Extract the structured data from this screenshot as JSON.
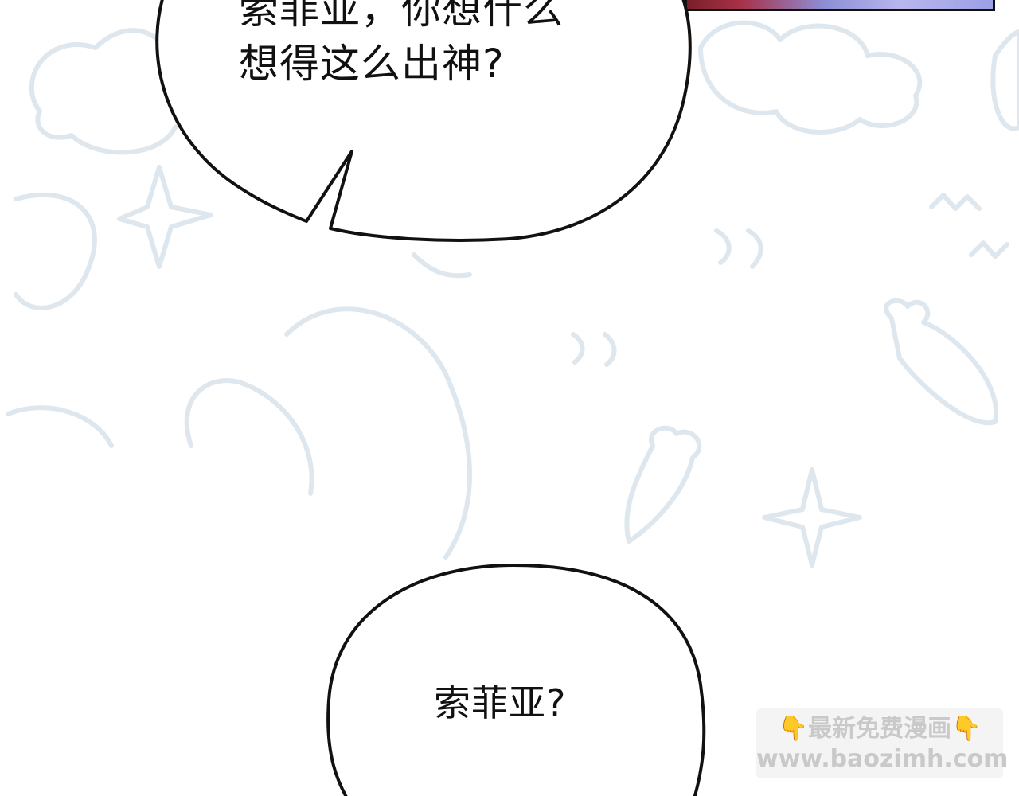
{
  "bubbles": {
    "top": {
      "line1": "索菲亚，你想什么",
      "line2": "想得这么出神?"
    },
    "bottom": {
      "text": "索菲亚?"
    }
  },
  "watermark": {
    "title": "最新免费漫画",
    "url": "www.baozimh.com",
    "pointer_icon": "finger-pointing-down-icon"
  },
  "colors": {
    "background": "#ffffff",
    "bubble_fill": "#ffffff",
    "bubble_stroke": "#111111",
    "text": "#111111",
    "doodle_stroke": "#dfe7ee",
    "watermark_text": "#c9c9c9"
  }
}
